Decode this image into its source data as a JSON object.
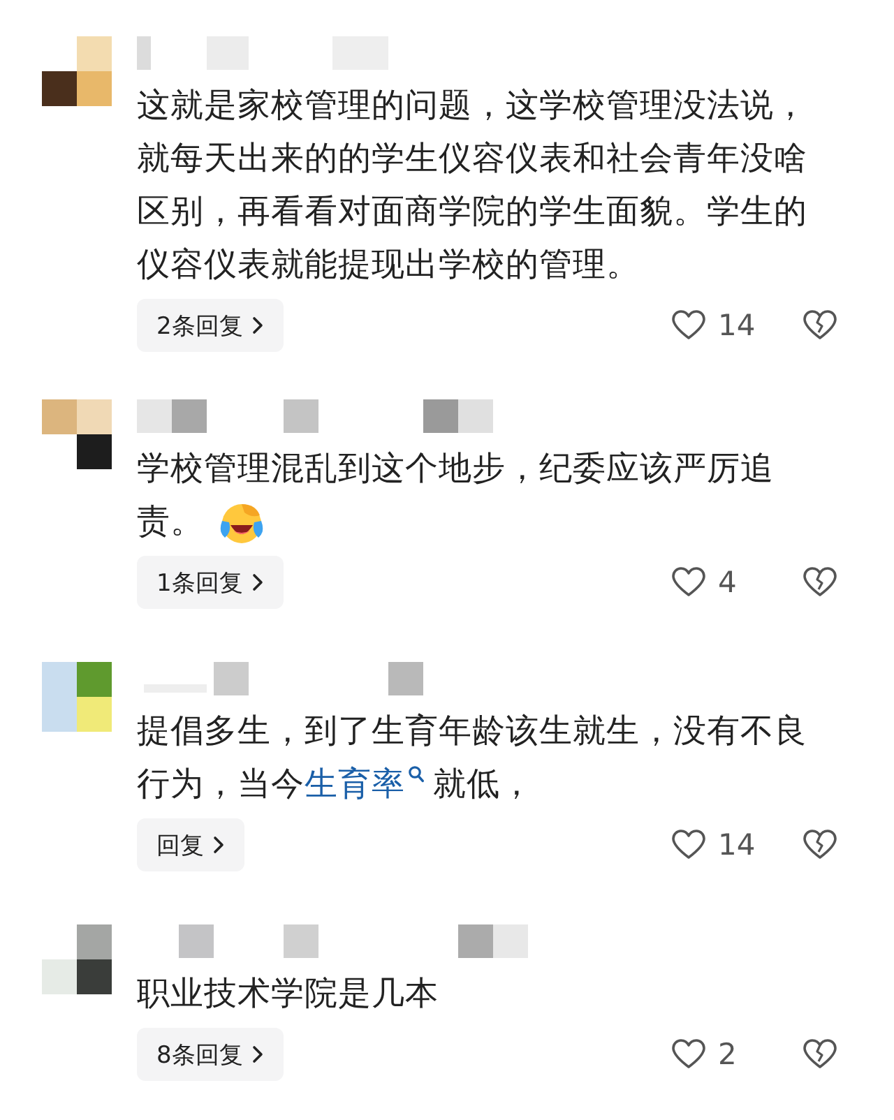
{
  "comments": [
    {
      "parts": [
        {
          "kind": "text",
          "text": "这就是家校管理的问题，这学校管理没法说，就每天出来的的学生仪容仪表和社会青年没啥区别，再看看对面商学院的学生面貌。学生的仪容仪表就能提现出学校的管理。"
        }
      ],
      "replies": "2条回复",
      "likes": "14"
    },
    {
      "parts": [
        {
          "kind": "text",
          "text": "学校管理混乱到这个地步，纪委应该严厉追责。"
        },
        {
          "kind": "emoji"
        }
      ],
      "replies": "1条回复",
      "likes": "4"
    },
    {
      "parts": [
        {
          "kind": "text",
          "text": "提倡多生，到了生育年龄该生就生，没有不良行为，当今"
        },
        {
          "kind": "link",
          "text": "生育率"
        },
        {
          "kind": "text",
          "text": "就低，"
        }
      ],
      "replies": "回复",
      "likes": "14"
    },
    {
      "parts": [
        {
          "kind": "text",
          "text": "职业技术学院是几本"
        }
      ],
      "replies": "8条回复",
      "likes": "2"
    }
  ]
}
